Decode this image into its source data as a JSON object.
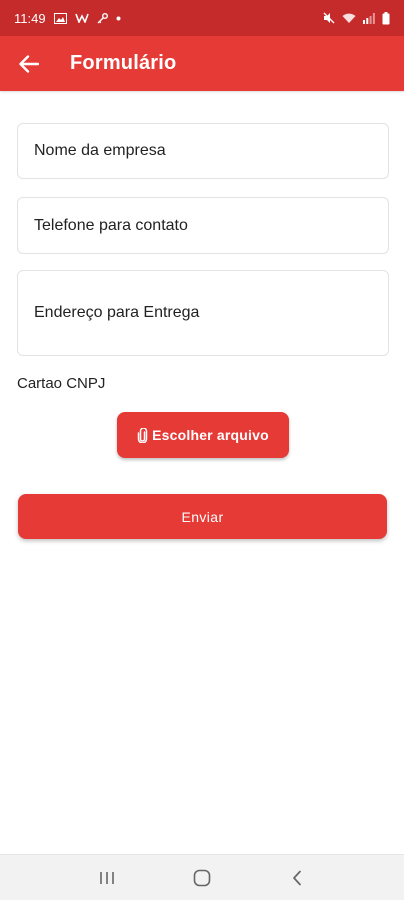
{
  "status_bar": {
    "time": "11:49",
    "icons_left": [
      "image-icon",
      "w-app-icon",
      "key-icon",
      "dot-icon"
    ],
    "icons_right": [
      "mute-icon",
      "wifi-icon",
      "signal-icon",
      "battery-icon"
    ]
  },
  "app_bar": {
    "title": "Formulário",
    "back_icon": "arrow-left-icon",
    "color": "#e53a36"
  },
  "form": {
    "company_placeholder": "Nome da empresa",
    "phone_placeholder": "Telefone para contato",
    "address_placeholder": "Endereço para Entrega",
    "cnpj_label": "Cartao CNPJ",
    "file_button_label": "Escolher arquivo",
    "file_button_icon": "paperclip-icon",
    "submit_label": "Enviar"
  },
  "nav_bar": {
    "buttons": [
      "recent-apps-icon",
      "home-icon",
      "back-icon"
    ]
  }
}
